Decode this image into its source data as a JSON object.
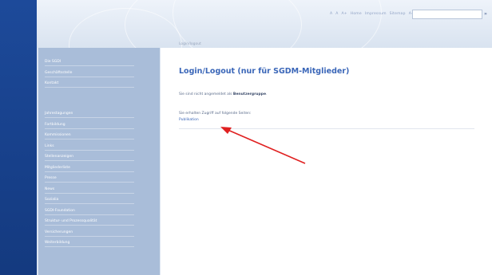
{
  "header": {
    "topnav": [
      "A",
      "A",
      "A+",
      "Home",
      "Impressum",
      "Sitemap",
      "A-Z"
    ],
    "search_go": "»"
  },
  "sidebar": {
    "group1": [
      "Die SGDI",
      "Geschäftsstelle",
      "Kontakt"
    ],
    "group2": [
      "Jahrestagungen",
      "Fortbildung",
      "Kommissionen",
      "Links",
      "Stellenanzeigen",
      "Mitgliederliste",
      "Presse",
      "News",
      "Sozialia",
      "SGDI-Foundation",
      "Struktur- und Prozessqualität",
      "Versicherungen",
      "Weiterbildung"
    ]
  },
  "main": {
    "breadcrumb": "Login/logout",
    "title": "Login/Logout (nur für SGDM-Mitglieder)",
    "status_prefix": "Sie sind nicht angemeldet als",
    "status_user": "Benutzergruppe",
    "status_suffix": ".",
    "access_label": "Sie erhalten Zugriff auf folgende Seiten:",
    "access_link": "Publikation"
  },
  "colors": {
    "accent": "#3a66b8",
    "sidebar": "#a9bdd9",
    "left_strip": "#1d4a9a",
    "annotation_arrow": "#e02020"
  }
}
